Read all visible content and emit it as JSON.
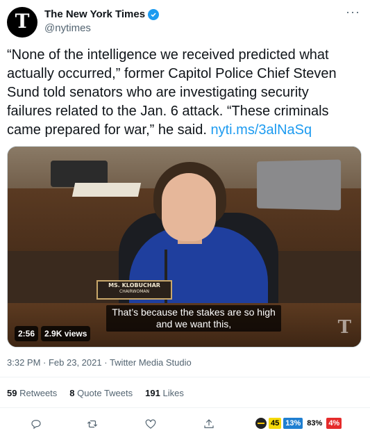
{
  "account": {
    "display_name": "The New York Times",
    "handle": "@nytimes",
    "avatar_letter": "T",
    "verified": true
  },
  "tweet": {
    "text": "“None of the intelligence we received predicted what actually occurred,” former Capitol Police Chief Steven Sund told senators who are investigating security failures related to the Jan. 6 attack. “These criminals came prepared for war,” he said. ",
    "link": "nyti.ms/3alNaSq",
    "timestamp": "3:32 PM · Feb 23, 2021",
    "source": "Twitter Media Studio"
  },
  "media": {
    "nameplate_name": "MS. KLOBUCHAR",
    "nameplate_title": "CHAIRWOMAN",
    "caption": "That’s because the stakes are so high and we want this,",
    "duration": "2:56",
    "views": "2.9K views",
    "watermark": "T"
  },
  "stats": {
    "retweets_count": "59",
    "retweets_label": "Retweets",
    "quotes_count": "8",
    "quotes_label": "Quote Tweets",
    "likes_count": "191",
    "likes_label": "Likes"
  },
  "extension": {
    "value1": "45",
    "value2": "13%",
    "value3": "83%",
    "value4": "4%"
  },
  "colors": {
    "link": "#1d9bf0",
    "secondary_text": "#536471",
    "verified": "#1d9bf0"
  },
  "icons": [
    "verified-badge-icon",
    "more-icon",
    "reply-icon",
    "retweet-icon",
    "like-icon",
    "share-icon"
  ]
}
